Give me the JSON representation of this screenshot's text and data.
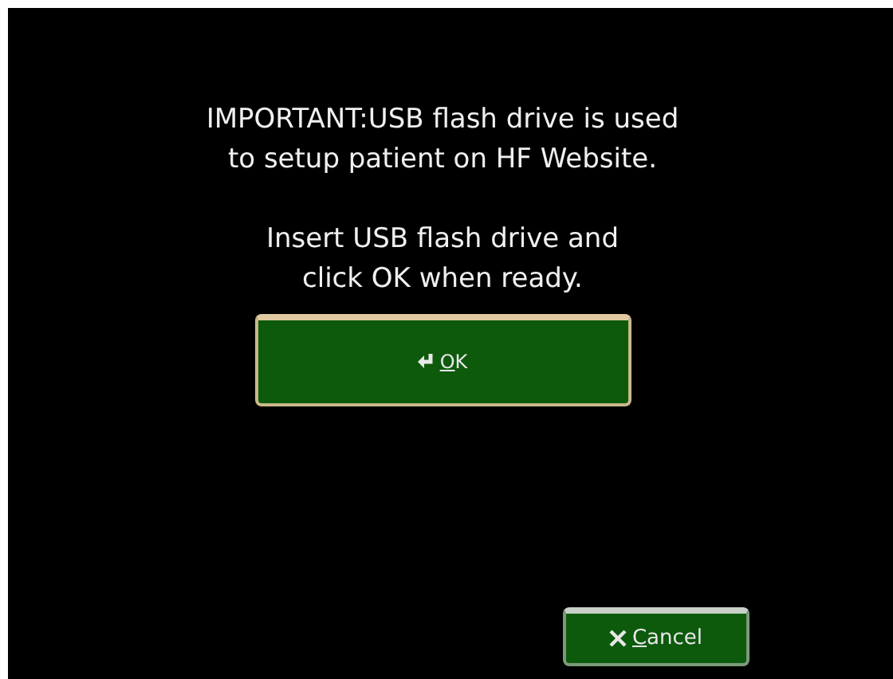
{
  "message": {
    "paragraphs": [
      [
        "IMPORTANT:USB flash drive is used",
        "to setup patient on HF Website."
      ],
      [
        "Insert USB flash drive and",
        "click OK when ready."
      ]
    ]
  },
  "ok_button": {
    "label_parts": [
      {
        "text": "O",
        "underlined": true
      },
      {
        "text": "K",
        "underlined": false
      }
    ]
  },
  "cancel_button": {
    "label_parts": [
      {
        "text": "C",
        "underlined": true
      },
      {
        "text": "ancel",
        "underlined": false
      }
    ]
  }
}
